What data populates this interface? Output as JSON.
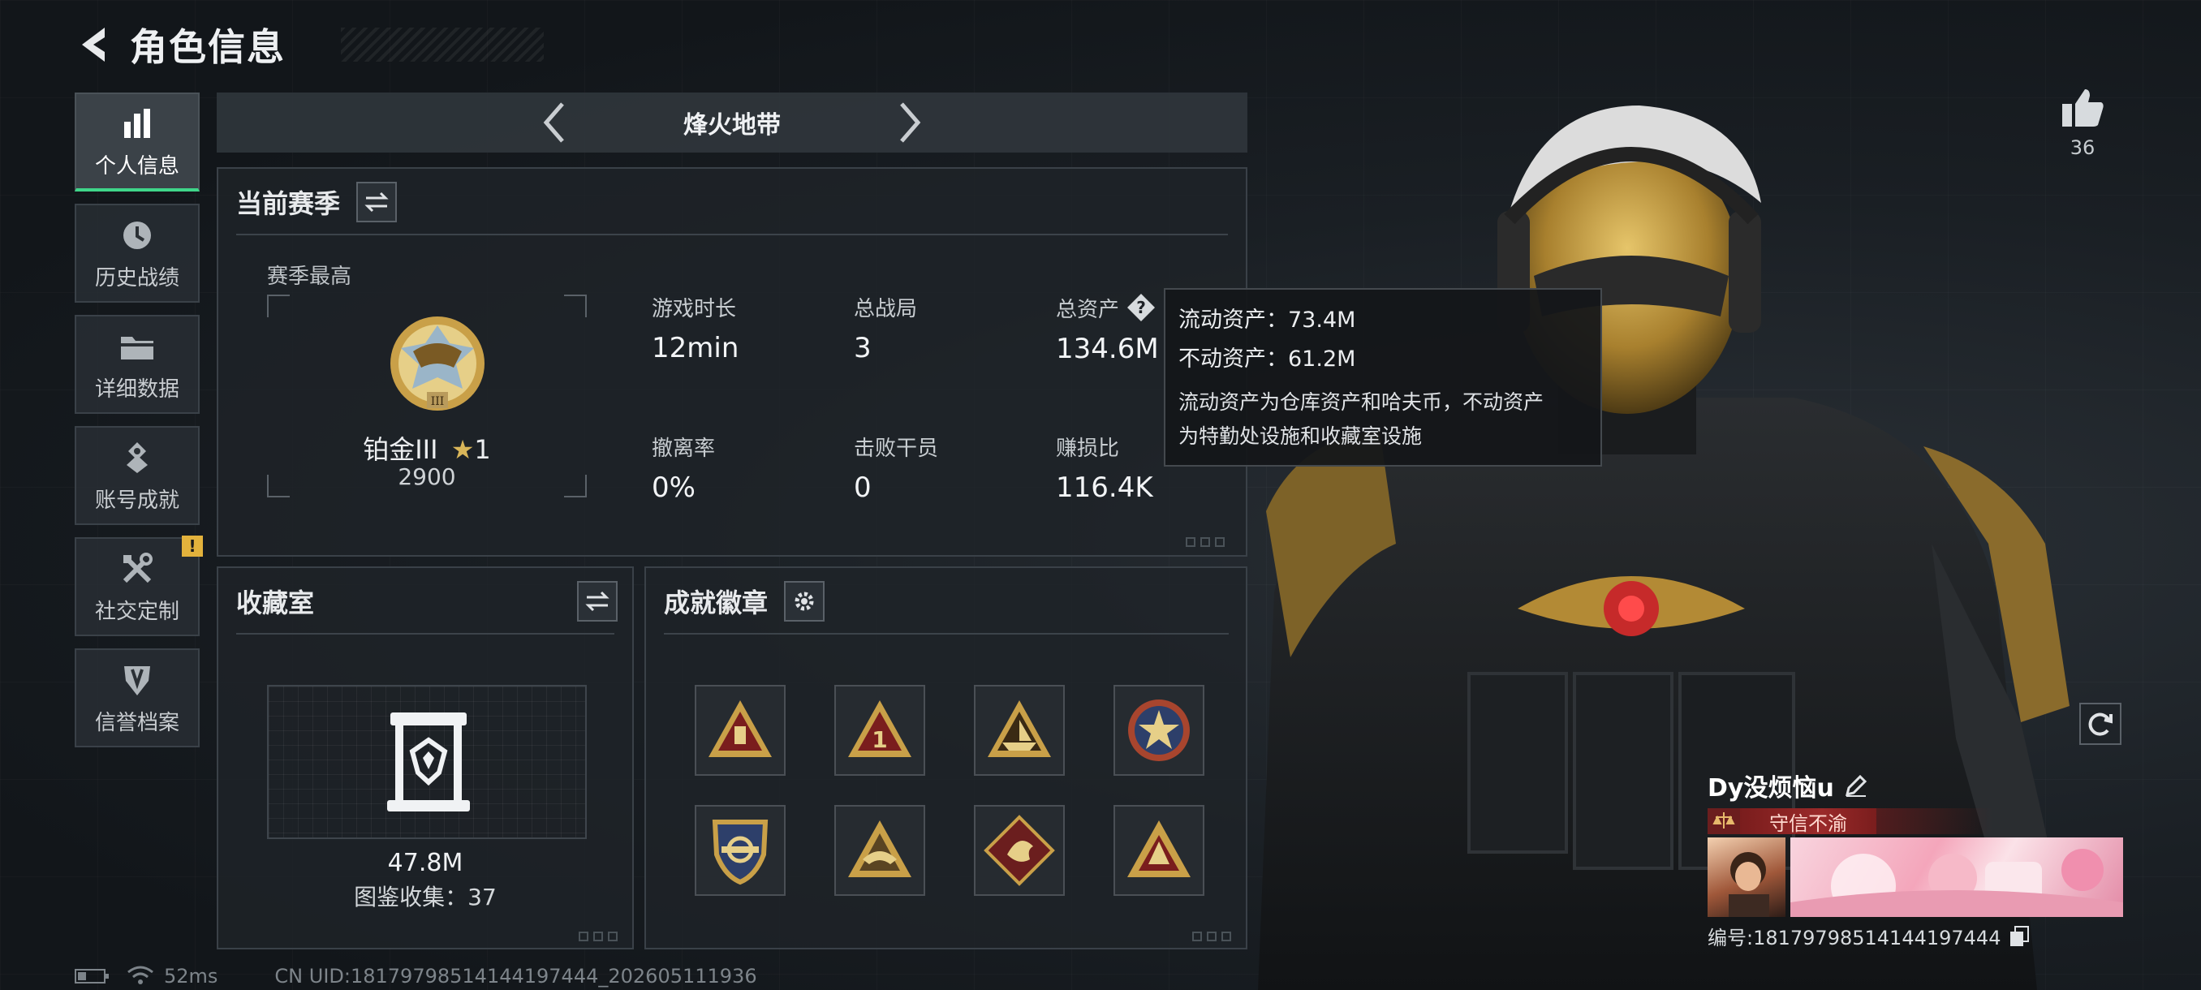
{
  "header": {
    "title": "角色信息"
  },
  "sidebar": {
    "items": [
      {
        "label": "个人信息",
        "icon": "bar-chart-icon",
        "active": true
      },
      {
        "label": "历史战绩",
        "icon": "history-icon"
      },
      {
        "label": "详细数据",
        "icon": "folder-icon"
      },
      {
        "label": "账号成就",
        "icon": "achievement-icon"
      },
      {
        "label": "社交定制",
        "icon": "tools-icon",
        "badge": "!"
      },
      {
        "label": "信誉档案",
        "icon": "shield-icon"
      }
    ]
  },
  "mode": {
    "title": "烽火地带"
  },
  "season": {
    "title": "当前赛季",
    "sub": "赛季最高",
    "rank_name": "铂金III",
    "rank_stars": "1",
    "rank_score": "2900",
    "stats": [
      {
        "label": "游戏时长",
        "value": "12min"
      },
      {
        "label": "总战局",
        "value": "3"
      },
      {
        "label": "总资产",
        "value": "134.6M"
      },
      {
        "label": "撤离率",
        "value": "0%"
      },
      {
        "label": "击败干员",
        "value": "0"
      },
      {
        "label": "赚损比",
        "value": "116.4K"
      }
    ]
  },
  "tooltip": {
    "line1": "流动资产：73.4M",
    "line2": "不动资产：61.2M",
    "desc1": "流动资产为仓库资产和哈夫币，不动资产",
    "desc2": "为特勤处设施和收藏室设施"
  },
  "collection": {
    "title": "收藏室",
    "value": "47.8M",
    "count": "图鉴收集：37"
  },
  "achievements": {
    "title": "成就徽章",
    "badges": [
      "triangle-badge",
      "rank-one-badge",
      "ship-badge",
      "star-medal-badge",
      "shield-badge",
      "eagle-badge",
      "dragon-badge",
      "mountain-badge"
    ]
  },
  "status": {
    "ping": "52ms",
    "uid": "CN UID:18179798514144197444_202605111936"
  },
  "profile": {
    "likes": "36",
    "player_name": "Dy没烦恼u",
    "title": "守信不渝",
    "id_text": "编号:18179798514144197444"
  },
  "colors": {
    "accent_green": "#3fd68a",
    "gold": "#c9a048",
    "badge_red": "#7a1d1d",
    "alert": "#e3b23c"
  }
}
